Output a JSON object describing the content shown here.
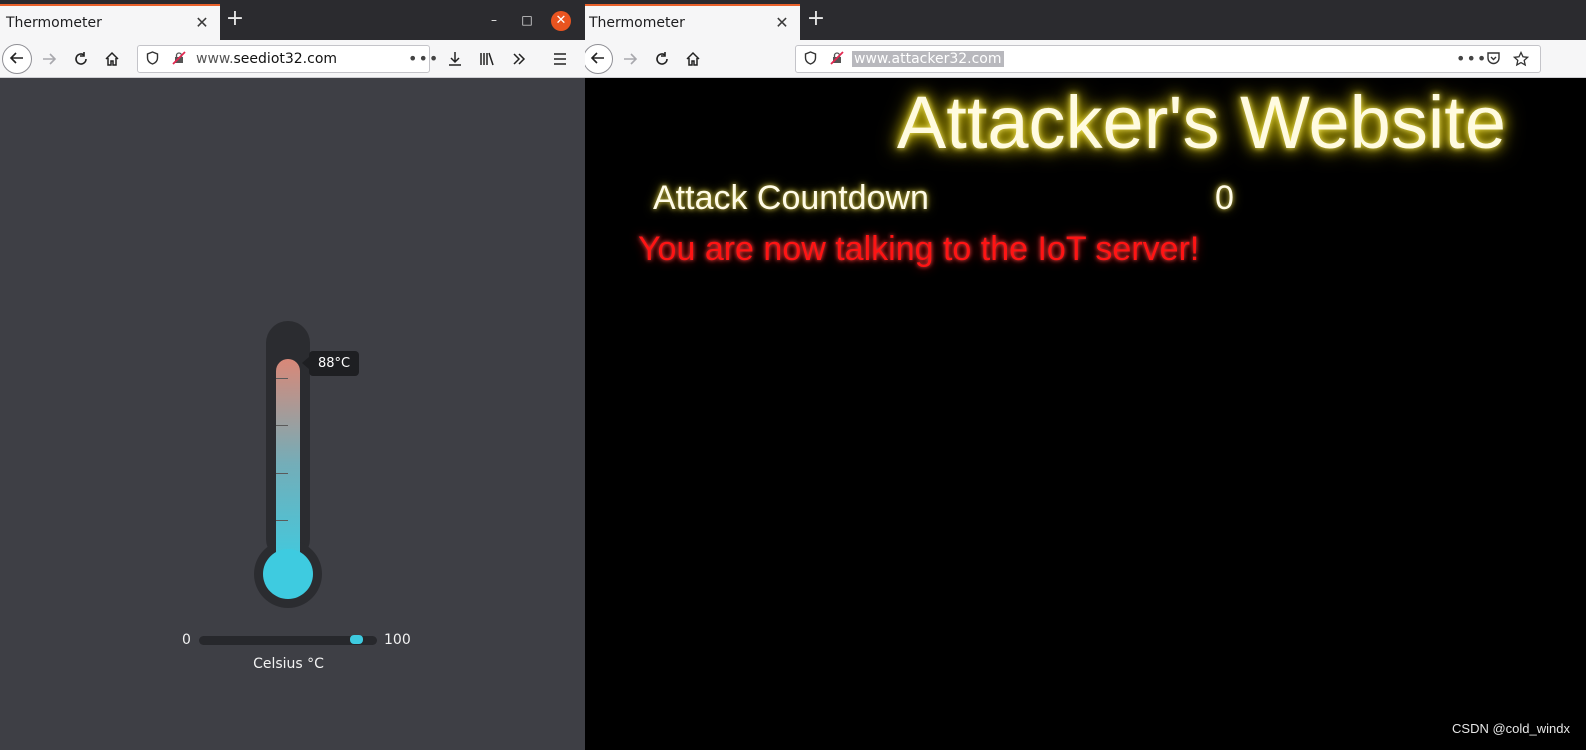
{
  "left_window": {
    "tab": {
      "title": "Thermometer",
      "close_label": "✕"
    },
    "new_tab_label": "+",
    "window_controls": {
      "minimize": "–",
      "maximize": "□",
      "close": "✕"
    },
    "url": {
      "prefix": "www.",
      "domain": "seediot32.com"
    },
    "url_more": "•••",
    "thermometer": {
      "value_label": "88°C",
      "value": 88,
      "min": "0",
      "max": "100",
      "unit_label": "Celsius °C"
    }
  },
  "right_window": {
    "tab": {
      "title": "Thermometer",
      "close_label": "✕"
    },
    "new_tab_label": "+",
    "url": {
      "text": "www.attacker32.com"
    },
    "url_more": "•••",
    "page": {
      "title": "Attacker's Website",
      "countdown_label": "Attack Countdown",
      "countdown_value": "0",
      "message": "You are now talking to the IoT server!"
    },
    "watermark": "CSDN @cold_windx"
  },
  "colors": {
    "tab_accent": "#e9612b",
    "thermo_hot": "#d98878",
    "thermo_cold": "#3ecbe0",
    "title_glow": "#e9d500",
    "message_red": "#ff1414"
  },
  "icons": {
    "back": "back-arrow-icon",
    "forward": "forward-arrow-icon",
    "reload": "reload-icon",
    "home": "home-icon",
    "shield": "shield-icon",
    "insecure": "insecure-lock-icon",
    "download": "download-icon",
    "library": "library-icon",
    "overflow": "overflow-chevron-icon",
    "menu": "hamburger-menu-icon",
    "pocket": "pocket-icon",
    "bookmark": "bookmark-star-icon"
  }
}
